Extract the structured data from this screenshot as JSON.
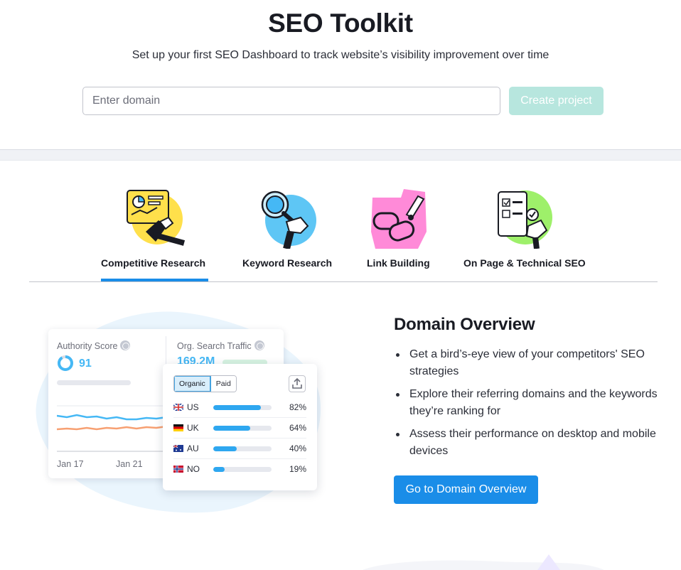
{
  "header": {
    "title": "SEO Toolkit",
    "subtitle": "Set up your first SEO Dashboard to track website’s visibility improvement over time",
    "domain_placeholder": "Enter domain",
    "domain_value": "",
    "create_button": "Create project"
  },
  "tabs": [
    {
      "label": "Competitive Research",
      "icon": "competitive-research-illustration",
      "active": true
    },
    {
      "label": "Keyword Research",
      "icon": "keyword-research-illustration",
      "active": false
    },
    {
      "label": "Link Building",
      "icon": "link-building-illustration",
      "active": false
    },
    {
      "label": "On Page & Technical SEO",
      "icon": "on-page-seo-illustration",
      "active": false
    }
  ],
  "preview": {
    "authority_label": "Authority Score",
    "authority_value": "91",
    "authority_ring_fraction": 0.91,
    "traffic_label": "Org. Search Traffic",
    "traffic_value": "169.2M",
    "dates": [
      "Jan 17",
      "Jan 21"
    ],
    "toggle": {
      "organic": "Organic",
      "paid": "Paid",
      "selected": "Organic"
    },
    "countries": [
      {
        "code": "US",
        "percent": "82%",
        "fraction": 0.82,
        "flag": "uk-flag-icon"
      },
      {
        "code": "UK",
        "percent": "64%",
        "fraction": 0.64,
        "flag": "germany-flag-icon"
      },
      {
        "code": "AU",
        "percent": "40%",
        "fraction": 0.4,
        "flag": "australia-flag-icon"
      },
      {
        "code": "NO",
        "percent": "19%",
        "fraction": 0.19,
        "flag": "norway-flag-icon"
      }
    ]
  },
  "feature": {
    "title": "Domain Overview",
    "bullets": [
      "Get a bird’s-eye view of your competitors' SEO strategies",
      "Explore their referring domains and the keywords they’re ranking for",
      "Assess their performance on desktop and mobile devices"
    ],
    "cta": "Go to Domain Overview"
  },
  "colors": {
    "accent": "#1a8de8",
    "create_button_disabled": "#b7e6de",
    "chart_blue": "#45b8f5",
    "chart_orange": "#f7a072"
  }
}
